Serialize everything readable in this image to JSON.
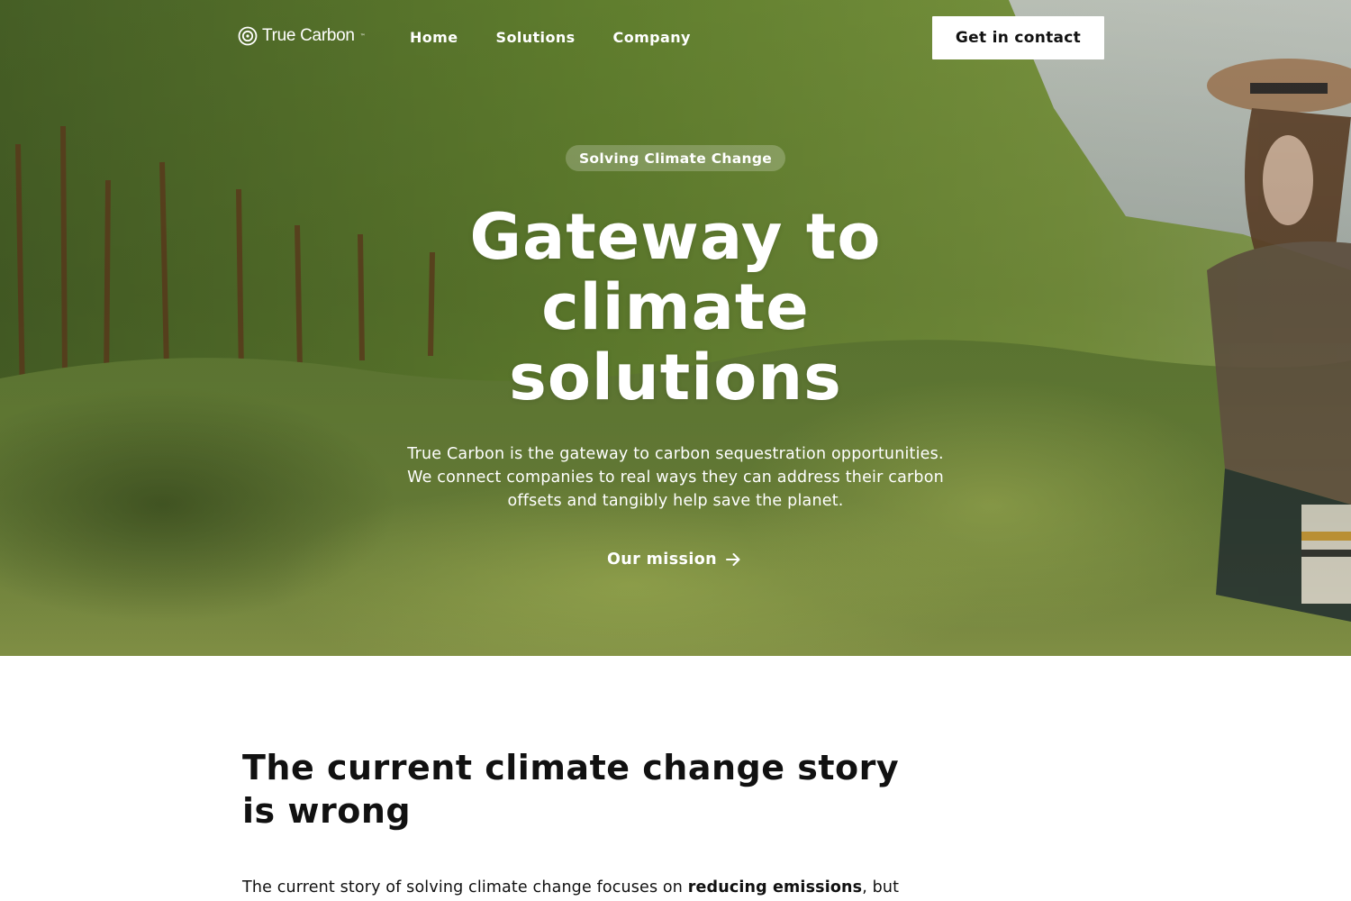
{
  "nav": {
    "logo_text": "True Carbon",
    "logo_tm": "™",
    "links": [
      {
        "label": "Home"
      },
      {
        "label": "Solutions"
      },
      {
        "label": "Company"
      }
    ],
    "cta_label": "Get in contact"
  },
  "hero": {
    "eyebrow": "Solving Climate Change",
    "title": "Gateway to climate solutions",
    "description": "True Carbon is the gateway to carbon sequestration opportunities. We connect companies to real ways they can address their carbon offsets and tangibly help save the planet.",
    "mission_label": "Our mission",
    "mission_icon": "arrow-right-icon",
    "background_icon": "field-photo"
  },
  "story": {
    "title": "The current climate change story is wrong",
    "text_prefix": "The current story of solving climate change focuses on ",
    "text_bold": "reducing emissions",
    "text_suffix": ", but"
  },
  "colors": {
    "hero_overlay": "#5f8236",
    "cta_bg": "#ffffff",
    "text_dark": "#111111"
  }
}
